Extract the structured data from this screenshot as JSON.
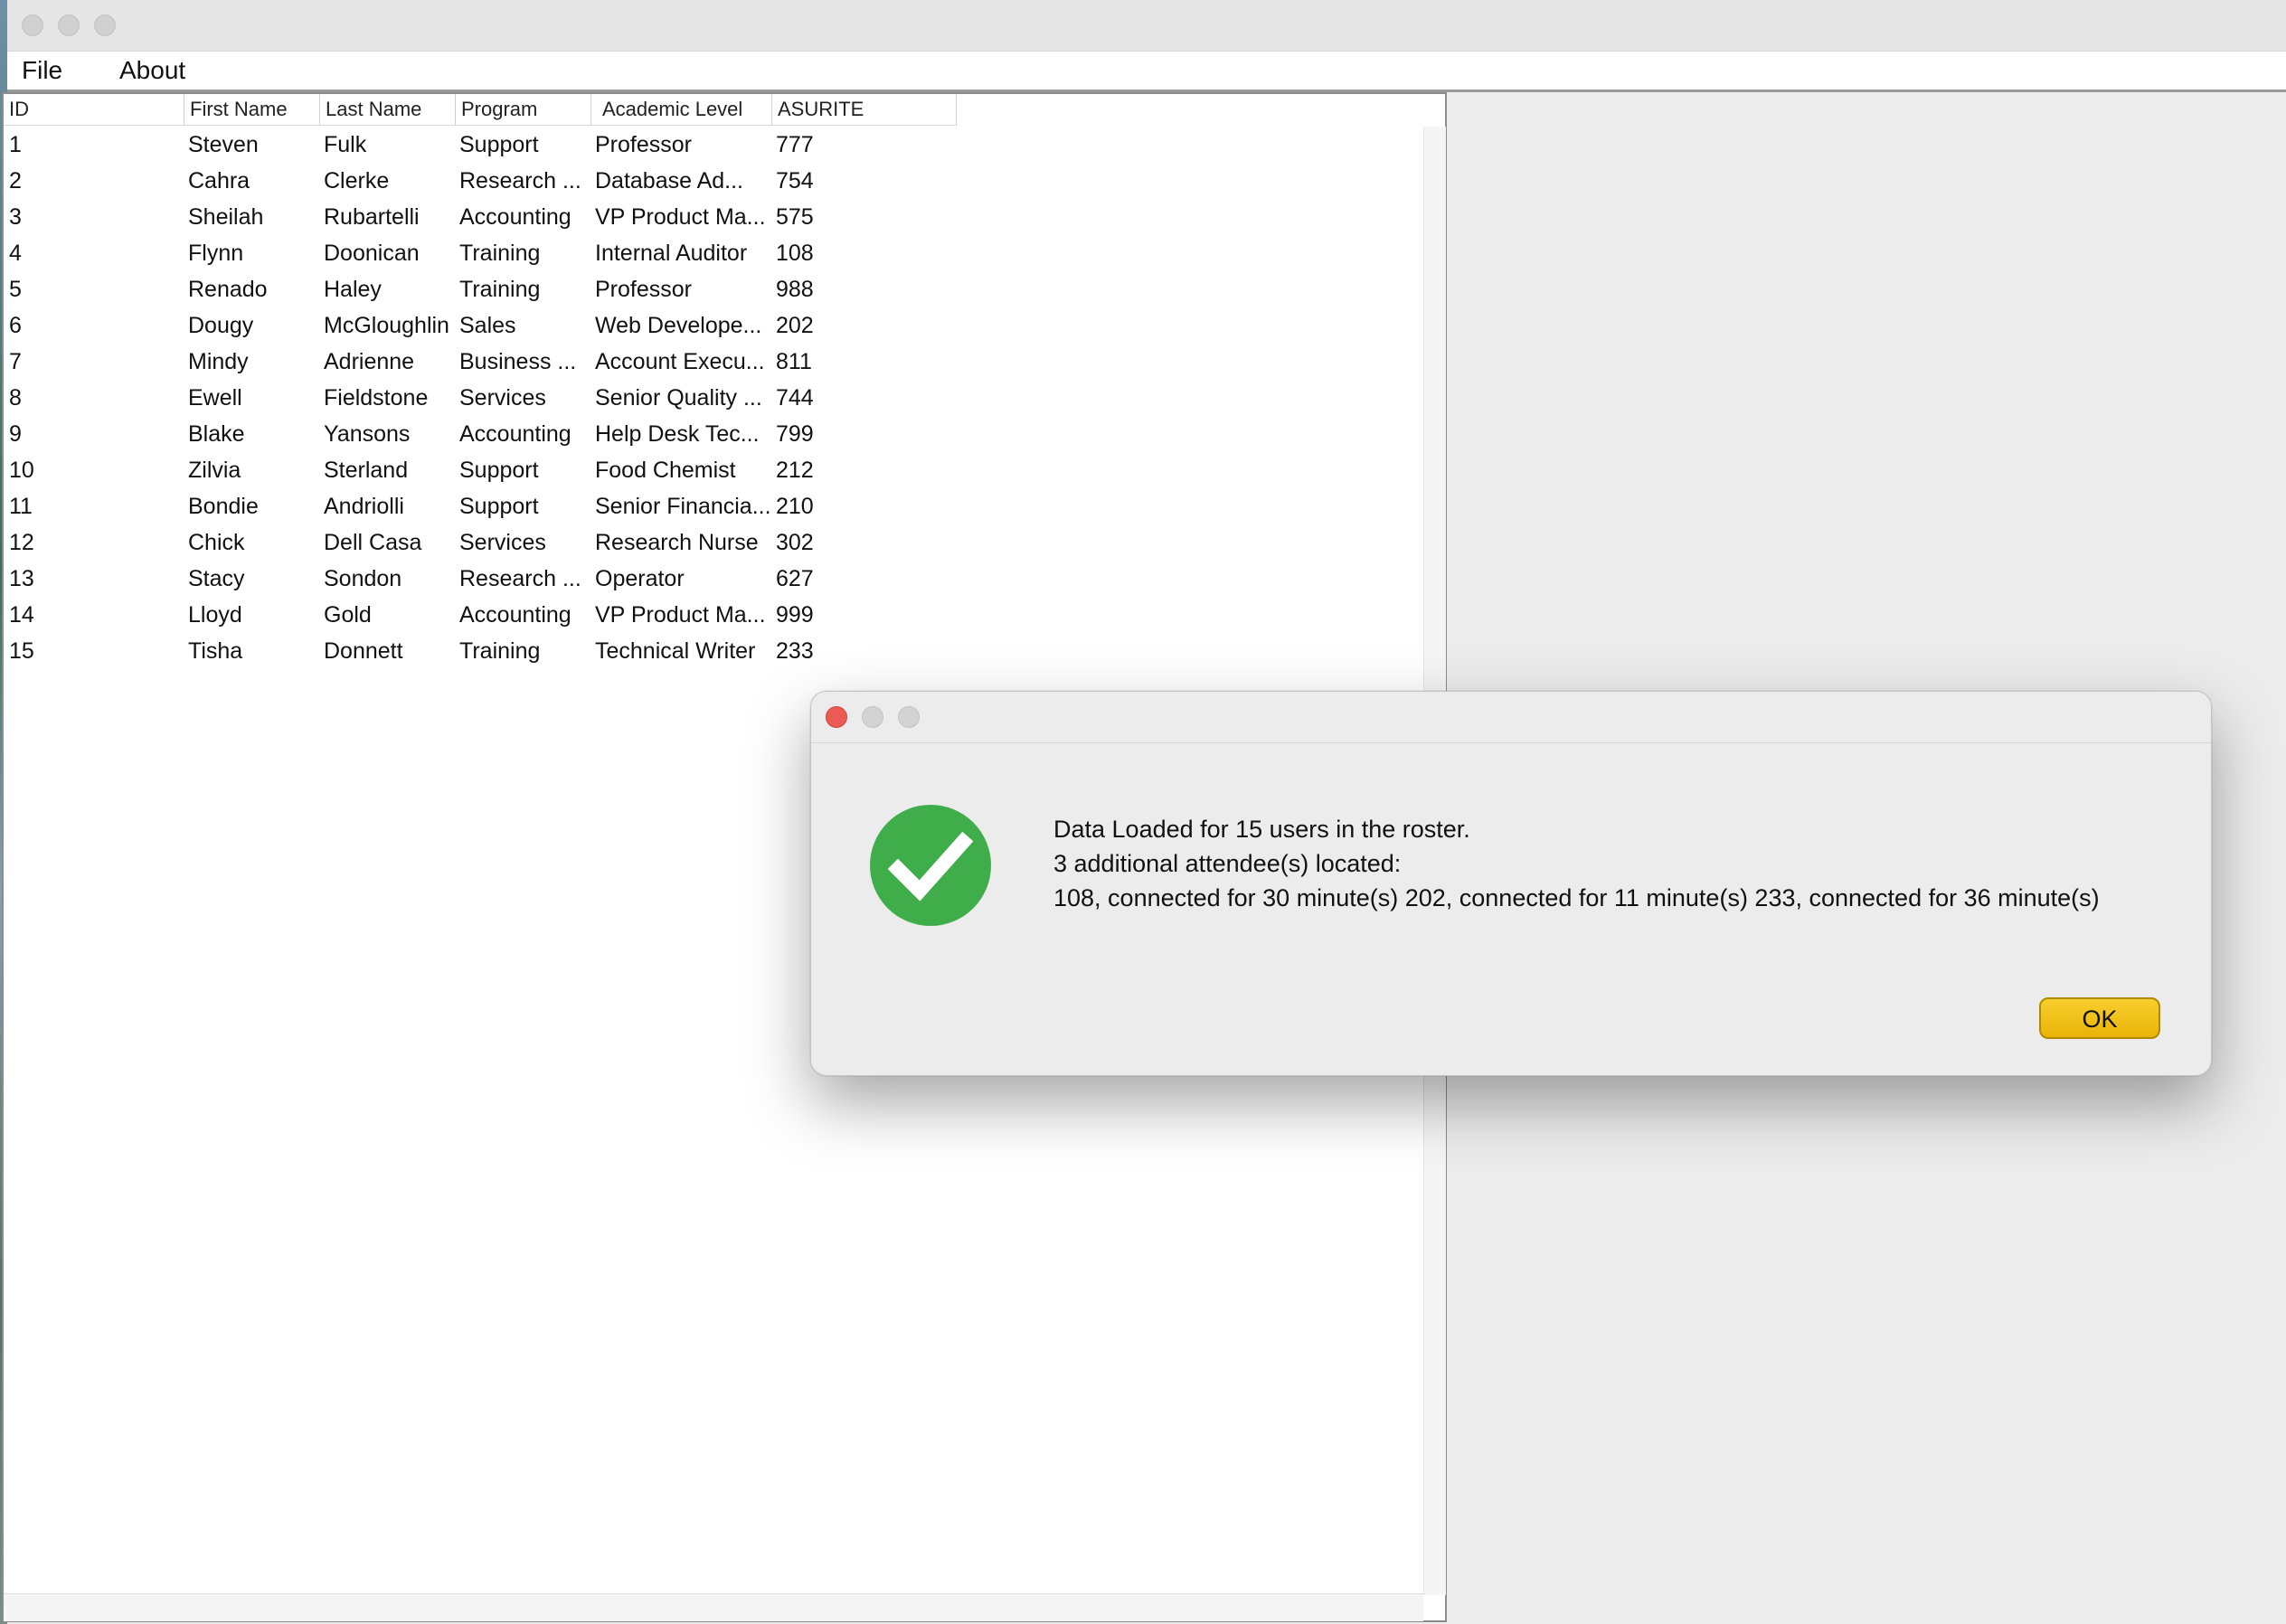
{
  "menu": {
    "items": [
      {
        "label": "File"
      },
      {
        "label": "About"
      }
    ]
  },
  "table": {
    "columns": [
      "ID",
      "First Name",
      "Last Name",
      "Program",
      "Academic Level",
      "ASURITE"
    ],
    "rows": [
      [
        "1",
        "Steven",
        "Fulk",
        "Support",
        "Professor",
        "777"
      ],
      [
        "2",
        "Cahra",
        "Clerke",
        "Research ...",
        "Database Ad...",
        "754"
      ],
      [
        "3",
        "Sheilah",
        "Rubartelli",
        "Accounting",
        "VP Product Ma...",
        "575"
      ],
      [
        "4",
        "Flynn",
        "Doonican",
        "Training",
        "Internal Auditor",
        "108"
      ],
      [
        "5",
        "Renado",
        "Haley",
        "Training",
        "Professor",
        "988"
      ],
      [
        "6",
        "Dougy",
        "McGloughlin",
        "Sales",
        "Web Develope...",
        "202"
      ],
      [
        "7",
        "Mindy",
        "Adrienne",
        "Business ...",
        "Account Execu...",
        "811"
      ],
      [
        "8",
        "Ewell",
        "Fieldstone",
        "Services",
        "Senior Quality ...",
        "744"
      ],
      [
        "9",
        "Blake",
        "Yansons",
        "Accounting",
        "Help Desk Tec...",
        "799"
      ],
      [
        "10",
        "Zilvia",
        "Sterland",
        "Support",
        "Food Chemist",
        "212"
      ],
      [
        "11",
        "Bondie",
        "Andriolli",
        "Support",
        "Senior Financia...",
        "210"
      ],
      [
        "12",
        "Chick",
        "Dell Casa",
        "Services",
        "Research Nurse",
        "302"
      ],
      [
        "13",
        "Stacy",
        "Sondon",
        "Research ...",
        "Operator",
        "627"
      ],
      [
        "14",
        "Lloyd",
        "Gold",
        "Accounting",
        "VP Product Ma...",
        "999"
      ],
      [
        "15",
        "Tisha",
        "Donnett",
        "Training",
        "Technical Writer",
        "233"
      ]
    ]
  },
  "dialog": {
    "icon": "checkmark-success-icon",
    "icon_color": "#3fae4a",
    "lines": [
      "Data Loaded for 15 users in the roster.",
      "3 additional attendee(s) located:",
      "108, connected for 30 minute(s) 202, connected for 11 minute(s) 233, connected for 36 minute(s)"
    ],
    "ok_label": "OK",
    "ok_color": "#f1c21b",
    "close_color": "#ec5a55"
  }
}
